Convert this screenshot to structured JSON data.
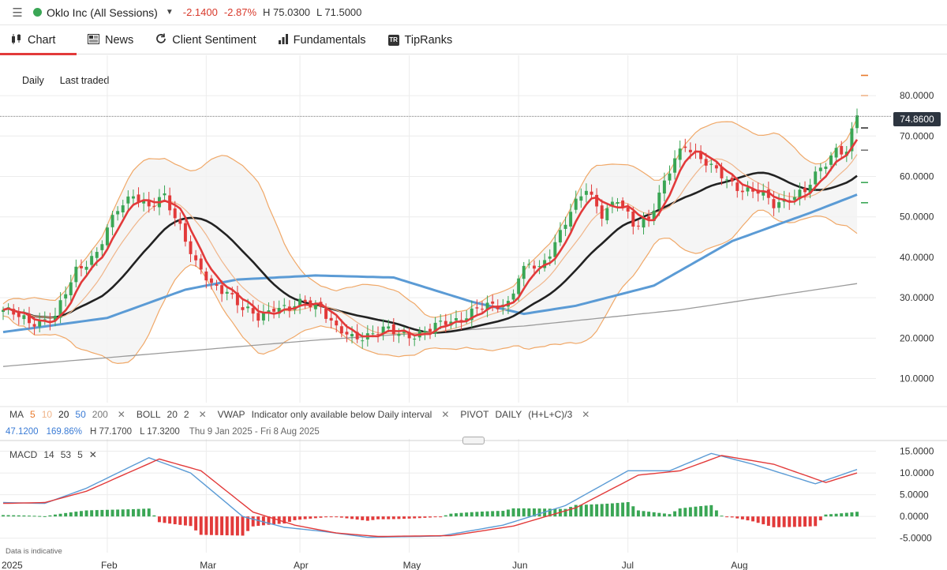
{
  "header": {
    "instrument": "Oklo Inc (All Sessions)",
    "change": "-2.1400",
    "change_pct": "-2.87%",
    "high": "H 75.0300",
    "low": "L 71.5000"
  },
  "tabs": [
    {
      "label": "Chart",
      "icon": "candlestick-icon"
    },
    {
      "label": "News",
      "icon": "newspaper-icon"
    },
    {
      "label": "Client Sentiment",
      "icon": "refresh-icon"
    },
    {
      "label": "Fundamentals",
      "icon": "bar-chart-icon"
    },
    {
      "label": "TipRanks",
      "icon": "tipranks-icon"
    }
  ],
  "chart_header": {
    "interval": "Daily",
    "price_type": "Last traded"
  },
  "last_price": "74.8600",
  "indicators": {
    "ma_label": "MA",
    "ma_periods": [
      "5",
      "10",
      "20",
      "50",
      "200"
    ],
    "boll_label": "BOLL",
    "boll_period": "20",
    "boll_dev": "2",
    "vwap_label": "VWAP",
    "vwap_note": "Indicator only available below Daily interval",
    "pivot_label": "PIVOT",
    "pivot_period": "DAILY",
    "pivot_formula": "(H+L+C)/3"
  },
  "stats": {
    "value": "47.1200",
    "pct": "169.86%",
    "high": "H 77.1700",
    "low": "L 17.3200",
    "range": "Thu 9 Jan 2025 - Fri 8 Aug 2025"
  },
  "macd": {
    "label": "MACD",
    "fast": "14",
    "slow": "53",
    "signal": "5"
  },
  "disclaimer": "Data is indicative",
  "colors": {
    "up": "#3aa655",
    "down": "#e23a3a",
    "ma5": "#e23a3a",
    "ma10": "#f0b58a",
    "ma20": "#222222",
    "ma50": "#5b9bd5",
    "ma200": "#9a9a9a",
    "boll": "#f0a868",
    "macd_line": "#5b9bd5",
    "signal_line": "#e23a3a"
  },
  "chart_data": {
    "type": "candlestick",
    "x_ticks": [
      "2025",
      "Feb",
      "Mar",
      "Apr",
      "May",
      "Jun",
      "Jul",
      "Aug"
    ],
    "price_ticks": [
      "80.0000",
      "70.0000",
      "60.0000",
      "50.0000",
      "40.0000",
      "30.0000",
      "20.0000",
      "10.0000"
    ],
    "price_range": [
      6,
      89
    ],
    "macd_ticks": [
      "15.0000",
      "10.0000",
      "5.0000",
      "0.0000",
      "-5.0000"
    ],
    "macd_range": [
      -6.5,
      16
    ],
    "pivot_levels": [
      85,
      80,
      72,
      66.5,
      58.5,
      53.5
    ],
    "anchors": [
      [
        0,
        27
      ],
      [
        5,
        24
      ],
      [
        10,
        25
      ],
      [
        14,
        37
      ],
      [
        18,
        41
      ],
      [
        22,
        52
      ],
      [
        25,
        56
      ],
      [
        28,
        52
      ],
      [
        31,
        55
      ],
      [
        34,
        48
      ],
      [
        37,
        38
      ],
      [
        40,
        33
      ],
      [
        43,
        32
      ],
      [
        46,
        27
      ],
      [
        49,
        25
      ],
      [
        52,
        28
      ],
      [
        55,
        27
      ],
      [
        58,
        29
      ],
      [
        61,
        28
      ],
      [
        64,
        22
      ],
      [
        67,
        20
      ],
      [
        70,
        21
      ],
      [
        73,
        22
      ],
      [
        76,
        21
      ],
      [
        79,
        21
      ],
      [
        82,
        22
      ],
      [
        85,
        24
      ],
      [
        88,
        25
      ],
      [
        91,
        27
      ],
      [
        94,
        28
      ],
      [
        97,
        29
      ],
      [
        99,
        35
      ],
      [
        101,
        38
      ],
      [
        103,
        37
      ],
      [
        106,
        44
      ],
      [
        109,
        51
      ],
      [
        112,
        57
      ],
      [
        115,
        51
      ],
      [
        118,
        54
      ],
      [
        121,
        48
      ],
      [
        124,
        50
      ],
      [
        127,
        58
      ],
      [
        129,
        64
      ],
      [
        131,
        68
      ],
      [
        133,
        66
      ],
      [
        136,
        62
      ],
      [
        139,
        59
      ],
      [
        142,
        57
      ],
      [
        145,
        56
      ],
      [
        148,
        53
      ],
      [
        151,
        55
      ],
      [
        154,
        56
      ],
      [
        157,
        62
      ],
      [
        160,
        67
      ],
      [
        162,
        66
      ],
      [
        164,
        75
      ]
    ],
    "macd_anchors": [
      [
        0,
        3.2
      ],
      [
        8,
        3.0
      ],
      [
        16,
        6.5
      ],
      [
        28,
        13.5
      ],
      [
        36,
        10
      ],
      [
        46,
        0
      ],
      [
        54,
        -2.5
      ],
      [
        62,
        -3.5
      ],
      [
        70,
        -4.8
      ],
      [
        84,
        -4.5
      ],
      [
        96,
        -2.0
      ],
      [
        108,
        2.5
      ],
      [
        120,
        10.5
      ],
      [
        128,
        10.5
      ],
      [
        136,
        14.5
      ],
      [
        144,
        12
      ],
      [
        156,
        7.5
      ],
      [
        164,
        10.8
      ]
    ],
    "signal_anchors": [
      [
        0,
        3.0
      ],
      [
        8,
        3.2
      ],
      [
        16,
        5.8
      ],
      [
        30,
        13.2
      ],
      [
        38,
        10.5
      ],
      [
        48,
        1
      ],
      [
        56,
        -2.0
      ],
      [
        64,
        -3.8
      ],
      [
        72,
        -4.6
      ],
      [
        86,
        -4.4
      ],
      [
        98,
        -2.2
      ],
      [
        110,
        2.0
      ],
      [
        122,
        9.5
      ],
      [
        130,
        10.5
      ],
      [
        138,
        14
      ],
      [
        148,
        12
      ],
      [
        158,
        7.8
      ],
      [
        164,
        10
      ]
    ],
    "ma200_anchors": [
      [
        0,
        13
      ],
      [
        60,
        19.5
      ],
      [
        100,
        23
      ],
      [
        130,
        27
      ],
      [
        164,
        33.5
      ]
    ],
    "ma50_anchors": [
      [
        0,
        21.5
      ],
      [
        20,
        25
      ],
      [
        35,
        32
      ],
      [
        45,
        34.5
      ],
      [
        60,
        35.5
      ],
      [
        75,
        35
      ],
      [
        90,
        29
      ],
      [
        100,
        26
      ],
      [
        110,
        28
      ],
      [
        125,
        33
      ],
      [
        140,
        44
      ],
      [
        155,
        51
      ],
      [
        164,
        55.5
      ]
    ]
  }
}
